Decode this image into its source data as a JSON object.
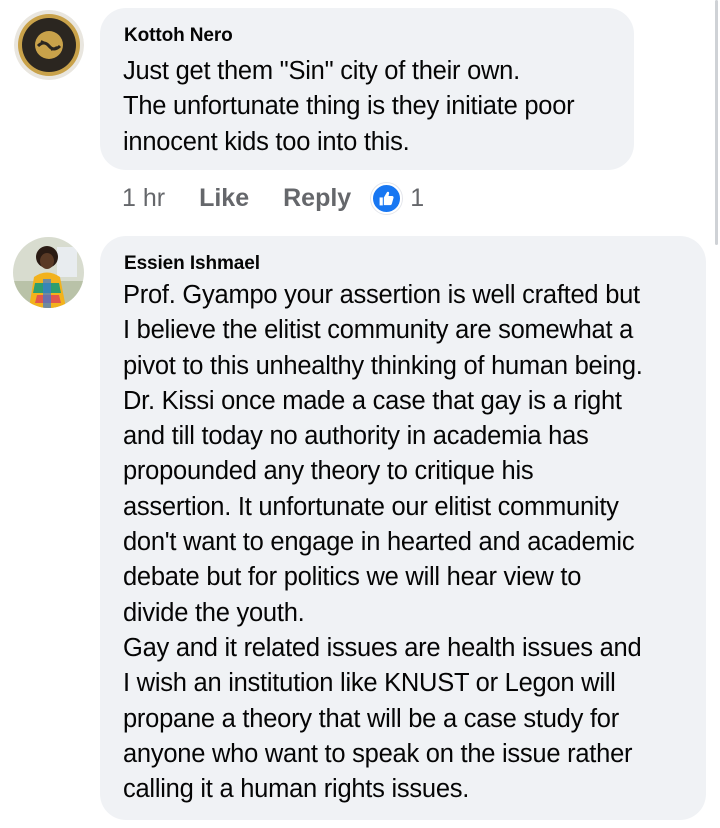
{
  "comments": [
    {
      "author": "Kottoh Nero",
      "avatar_icon": "together-we-can-badge-avatar",
      "text_lines": [
        "Just get them \"Sin\" city of their own.",
        "The unfortunate thing is they initiate poor",
        "innocent kids too into this."
      ],
      "time": "1 hr",
      "like_label": "Like",
      "reply_label": "Reply",
      "reaction_icon": "like-thumbs-up-icon",
      "reaction_count": "1"
    },
    {
      "author": "Essien Ishmael",
      "avatar_icon": "user-photo-avatar",
      "text_lines": [
        "Prof. Gyampo your assertion is well crafted but",
        "I believe the elitist community are somewhat a",
        "pivot to this unhealthy thinking of human being.",
        "Dr. Kissi once made a case that gay is a right",
        "and till today no authority in academia has",
        "propounded any theory to critique his",
        "assertion. It unfortunate our elitist community",
        "don't want to engage in hearted and academic",
        "debate but for politics we will hear view to",
        "divide the youth.",
        "Gay and it related issues are health issues and",
        "I wish an institution like KNUST or Legon will",
        "propane a theory that will  be a case study for",
        "anyone who want to speak on the issue rather",
        "calling it a human rights issues."
      ]
    }
  ],
  "colors": {
    "bubble_bg": "#f0f2f5",
    "meta_text": "#65676b",
    "like_blue": "#1877f2"
  }
}
